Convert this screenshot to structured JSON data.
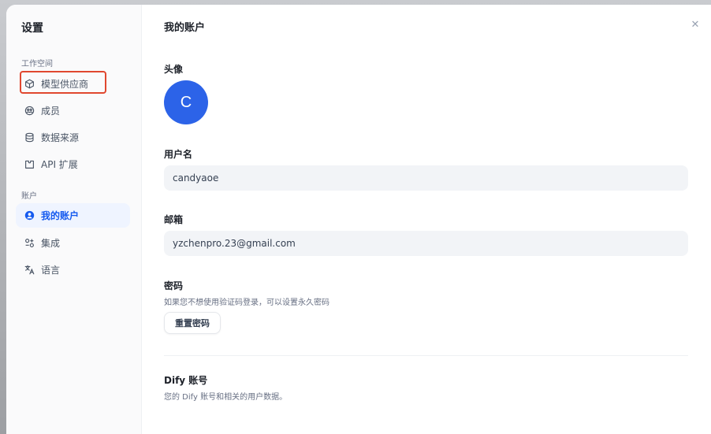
{
  "sidebar": {
    "title": "设置",
    "workspace_label": "工作空间",
    "account_label": "账户",
    "items": [
      {
        "label": "模型供应商",
        "icon": "cube-icon"
      },
      {
        "label": "成员",
        "icon": "members-icon"
      },
      {
        "label": "数据来源",
        "icon": "database-icon"
      },
      {
        "label": "API 扩展",
        "icon": "api-extension-icon"
      },
      {
        "label": "我的账户",
        "icon": "user-circle-icon"
      },
      {
        "label": "集成",
        "icon": "integration-icon"
      },
      {
        "label": "语言",
        "icon": "translate-icon"
      }
    ]
  },
  "main": {
    "title": "我的账户",
    "avatar_label": "头像",
    "avatar_initial": "C",
    "username_label": "用户名",
    "username_value": "candyaoe",
    "email_label": "邮箱",
    "email_value": "yzchenpro.23@gmail.com",
    "password_label": "密码",
    "password_hint": "如果您不想使用验证码登录，可以设置永久密码",
    "reset_password_button": "重置密码",
    "dify_account_label": "Dify 账号",
    "dify_account_hint": "您的 Dify 账号和相关的用户数据。"
  },
  "colors": {
    "accent": "#155aef",
    "avatar_bg": "#2c63e8",
    "highlight_border": "#e0472f"
  }
}
